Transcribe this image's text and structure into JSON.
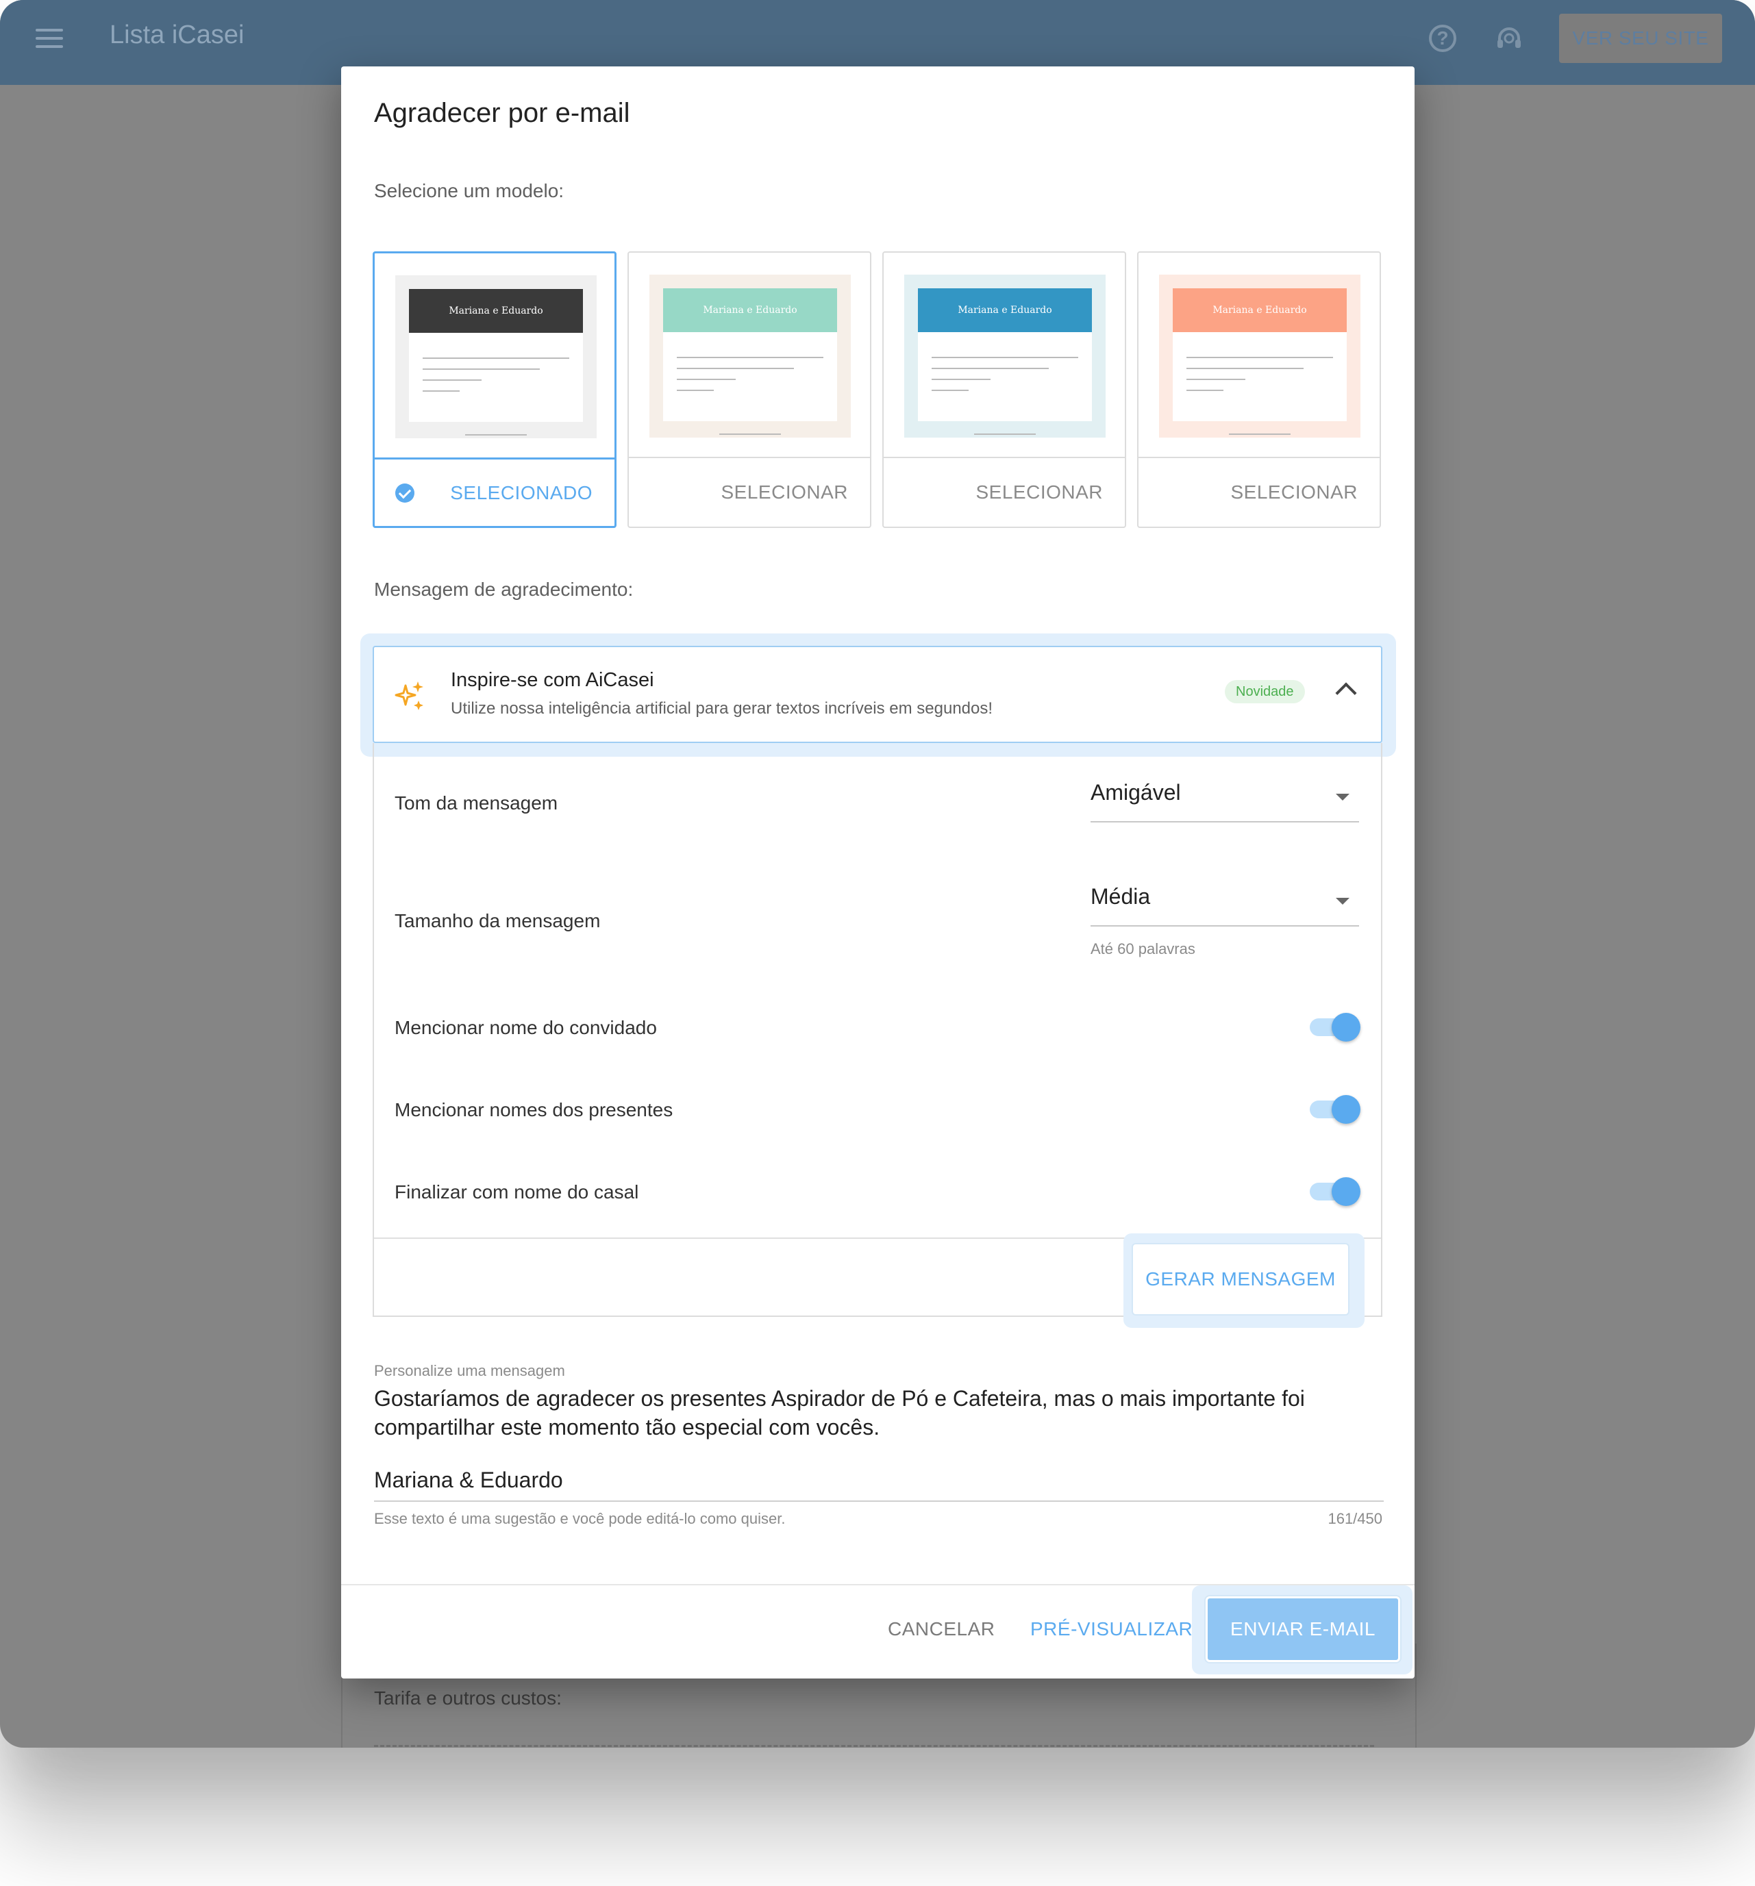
{
  "app": {
    "title": "Lista iCasei",
    "site_button": "VER SEU SITE"
  },
  "background": {
    "section_label": "Tarifa e outros custos:"
  },
  "dialog": {
    "title": "Agradecer por e-mail",
    "template_label": "Selecione um modelo:",
    "templates": [
      {
        "couple": "Mariana e Eduardo",
        "header_color": "#3a3a3a",
        "bg_color": "#f0f0f0",
        "action": "SELECIONADO",
        "selected": true
      },
      {
        "couple": "Mariana e Eduardo",
        "header_color": "#97d8c6",
        "bg_color": "#f6efe8",
        "action": "SELECIONAR",
        "selected": false
      },
      {
        "couple": "Mariana e Eduardo",
        "header_color": "#3396c4",
        "bg_color": "#e2f0f3",
        "action": "SELECIONAR",
        "selected": false
      },
      {
        "couple": "Mariana e Eduardo",
        "header_color": "#fca385",
        "bg_color": "#fdeae2",
        "action": "SELECIONAR",
        "selected": false
      }
    ],
    "message_label": "Mensagem de agradecimento:",
    "ai": {
      "title": "Inspire-se com AiCasei",
      "subtitle": "Utilize nossa inteligência artificial para gerar textos incríveis em segundos!",
      "badge": "Novidade",
      "tone_label": "Tom da mensagem",
      "tone_value": "Amigável",
      "size_label": "Tamanho da mensagem",
      "size_value": "Média",
      "size_hint": "Até 60 palavras",
      "toggle_guest_label": "Mencionar nome do convidado",
      "toggle_gifts_label": "Mencionar nomes dos presentes",
      "toggle_couple_label": "Finalizar com nome do casal",
      "toggles_on": [
        true,
        true,
        true
      ],
      "generate_button": "GERAR MENSAGEM"
    },
    "message": {
      "label": "Personalize uma mensagem",
      "text": "Gostaríamos de agradecer os presentes Aspirador de Pó e Cafeteira, mas o mais importante foi compartilhar este momento tão especial com vocês.",
      "signature": "Mariana & Eduardo",
      "hint": "Esse texto é uma sugestão e você pode editá-lo como quiser.",
      "counter": "161/450"
    },
    "buttons": {
      "cancel": "CANCELAR",
      "preview": "PRÉ-VISUALIZAR",
      "send": "ENVIAR E-MAIL"
    }
  },
  "colors": {
    "accent": "#5aaaef",
    "topbar": "#4b6983",
    "badge_green": "#4caf50",
    "sparkle_orange": "#f5a623"
  }
}
